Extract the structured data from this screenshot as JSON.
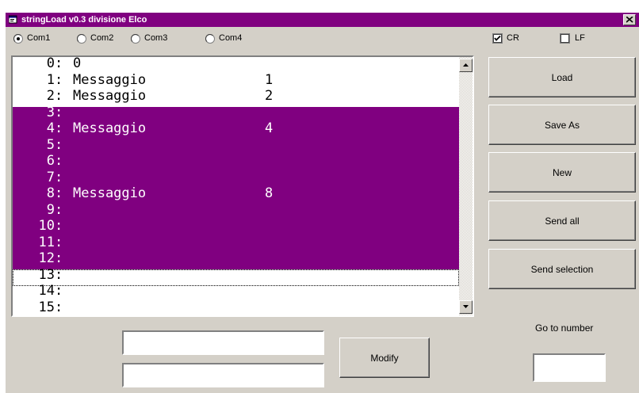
{
  "window": {
    "title": "stringLoad v0.3 divisione Elco"
  },
  "ports": [
    {
      "label": "Com1",
      "selected": true
    },
    {
      "label": "Com2",
      "selected": false
    },
    {
      "label": "Com3",
      "selected": false
    },
    {
      "label": "Com4",
      "selected": false
    }
  ],
  "options": {
    "cr": {
      "label": "CR",
      "checked": true
    },
    "lf": {
      "label": "LF",
      "checked": false
    }
  },
  "list": {
    "rows": [
      {
        "n": "0",
        "text": "0",
        "value": ""
      },
      {
        "n": "1",
        "text": "Messaggio",
        "value": "1"
      },
      {
        "n": "2",
        "text": "Messaggio",
        "value": "2"
      },
      {
        "n": "3",
        "text": "",
        "value": ""
      },
      {
        "n": "4",
        "text": "Messaggio",
        "value": "4"
      },
      {
        "n": "5",
        "text": "",
        "value": ""
      },
      {
        "n": "6",
        "text": "",
        "value": ""
      },
      {
        "n": "7",
        "text": "",
        "value": ""
      },
      {
        "n": "8",
        "text": "Messaggio",
        "value": "8"
      },
      {
        "n": "9",
        "text": "",
        "value": ""
      },
      {
        "n": "10",
        "text": "",
        "value": ""
      },
      {
        "n": "11",
        "text": "",
        "value": ""
      },
      {
        "n": "12",
        "text": "",
        "value": ""
      },
      {
        "n": "13",
        "text": "",
        "value": ""
      },
      {
        "n": "14",
        "text": "",
        "value": ""
      },
      {
        "n": "15",
        "text": "",
        "value": ""
      }
    ],
    "selected_rows": [
      "3",
      "4",
      "5",
      "6",
      "7",
      "8",
      "9",
      "10",
      "11",
      "12"
    ],
    "focused_row": "13"
  },
  "buttons": {
    "load": "Load",
    "save_as": "Save As",
    "new": "New",
    "send_all": "Send all",
    "send_selection": "Send selection",
    "modify": "Modify"
  },
  "goto": {
    "label": "Go to number",
    "value": ""
  },
  "edit": {
    "field1": "",
    "field2": ""
  },
  "colors": {
    "title_bar": "#800080",
    "selection": "#800080",
    "face": "#d4d0c8"
  }
}
